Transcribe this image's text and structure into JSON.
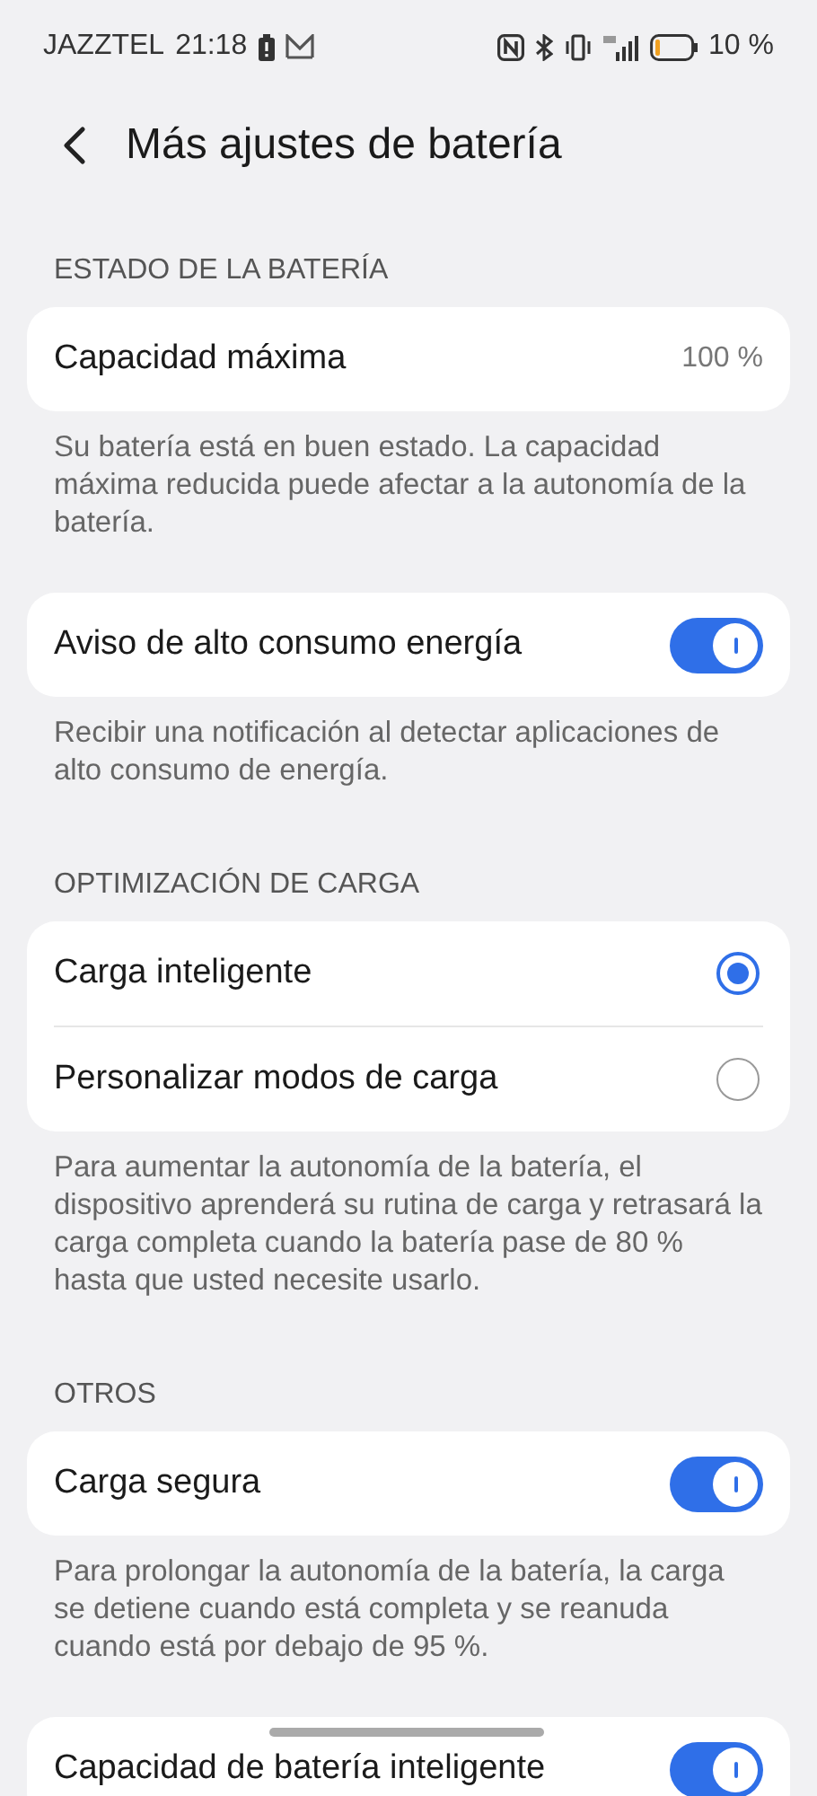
{
  "status_bar": {
    "carrier": "JAZZTEL",
    "time": "21:18",
    "battery_text": "10 %"
  },
  "header": {
    "title": "Más ajustes de batería"
  },
  "blocks": [
    {
      "kind": "heading",
      "text": "ESTADO DE LA BATERÍA"
    },
    {
      "kind": "card",
      "rows": [
        {
          "kind": "value",
          "label": "Capacidad máxima",
          "value": "100 %"
        }
      ]
    },
    {
      "kind": "note",
      "text": "Su batería está en buen estado. La capacidad máxima reducida puede afectar a la autonomía de la batería."
    },
    {
      "kind": "card",
      "rows": [
        {
          "kind": "switch",
          "label": "Aviso de alto consumo energía",
          "on": true
        }
      ]
    },
    {
      "kind": "note",
      "text": "Recibir una notificación al detectar aplicaciones de alto consumo de energía."
    },
    {
      "kind": "heading",
      "text": "OPTIMIZACIÓN DE CARGA"
    },
    {
      "kind": "card",
      "rows": [
        {
          "kind": "radio",
          "label": "Carga inteligente",
          "selected": true
        },
        {
          "kind": "radio",
          "label": "Personalizar modos de carga",
          "selected": false
        }
      ]
    },
    {
      "kind": "note",
      "text": "Para aumentar la autonomía de la batería, el dispositivo aprenderá su rutina de carga y retrasará la carga completa cuando la batería pase de 80 % hasta que usted necesite usarlo."
    },
    {
      "kind": "heading",
      "text": "OTROS"
    },
    {
      "kind": "card",
      "rows": [
        {
          "kind": "switch",
          "label": "Carga segura",
          "on": true
        }
      ]
    },
    {
      "kind": "note",
      "text": "Para prolongar la autonomía de la batería, la carga se detiene cuando está completa y se reanuda cuando está por debajo de 95 %."
    },
    {
      "kind": "card",
      "rows": [
        {
          "kind": "switch",
          "label": "Capacidad de batería inteligente",
          "on": true
        }
      ]
    }
  ]
}
